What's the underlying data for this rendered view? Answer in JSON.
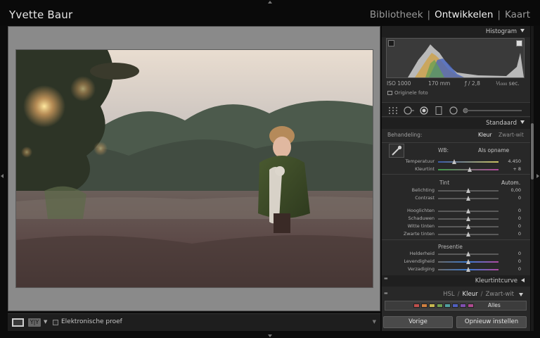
{
  "app": {
    "identity": "Yvette Baur",
    "modules": [
      {
        "label": "Bibliotheek",
        "active": false
      },
      {
        "label": "Ontwikkelen",
        "active": true
      },
      {
        "label": "Kaart",
        "active": false
      }
    ],
    "module_separator": "|"
  },
  "histogram": {
    "title": "Histogram",
    "iso": "ISO 1000",
    "focal": "170 mm",
    "aperture": "ƒ / 2,8",
    "shutter": "¹⁄₁₀₀₀ sec.",
    "original_photo": "Originele foto"
  },
  "basic": {
    "title": "Standaard",
    "treatment_label": "Behandeling:",
    "treatment_options": [
      "Kleur",
      "Zwart-wit"
    ],
    "treatment_selected": "Kleur",
    "wb_label": "WB:",
    "wb_value": "Als opname",
    "wb_sliders": [
      {
        "label": "Temperatuur",
        "value": "4.450",
        "position": 0.27
      },
      {
        "label": "Kleurtint",
        "value": "+ 8",
        "position": 0.52
      }
    ],
    "tone_label": "Tint",
    "auto_label": "Autom.",
    "tone_sliders": [
      {
        "label": "Belichting",
        "value": "0,00",
        "position": 0.5
      },
      {
        "label": "Contrast",
        "value": "0",
        "position": 0.5
      }
    ],
    "tone_sliders_2": [
      {
        "label": "Hooglichten",
        "value": "0",
        "position": 0.5
      },
      {
        "label": "Schaduwen",
        "value": "0",
        "position": 0.5
      },
      {
        "label": "Witte tinten",
        "value": "0",
        "position": 0.5
      },
      {
        "label": "Zwarte tinten",
        "value": "0",
        "position": 0.5
      }
    ],
    "presence_label": "Presentie",
    "presence_sliders": [
      {
        "label": "Helderheid",
        "value": "0",
        "position": 0.5
      },
      {
        "label": "Levendigheid",
        "value": "0",
        "position": 0.5
      },
      {
        "label": "Verzadiging",
        "value": "0",
        "position": 0.5
      }
    ]
  },
  "tone_curve": {
    "title": "Kleurtintcurve"
  },
  "hsl": {
    "tabs": [
      {
        "label": "HSL",
        "active": false
      },
      {
        "label": "Kleur",
        "active": true
      },
      {
        "label": "Zwart-wit",
        "active": false
      }
    ],
    "swatch_colors": [
      "#c0504d",
      "#d08040",
      "#c8b850",
      "#70a050",
      "#50a0a0",
      "#5060c0",
      "#8050b0",
      "#b04a90"
    ],
    "all_label": "Alles"
  },
  "toolbar": {
    "proof_label": "Elektronische proef",
    "proof_checked": false
  },
  "buttons": {
    "previous": "Vorige",
    "reset": "Opnieuw instellen"
  },
  "icons": {
    "panel_collapse": "triangle-down-icon",
    "tone_curve_expand": "triangle-left-icon",
    "eyedropper": "eyedropper-icon",
    "crop": "crop-grid-icon",
    "spot": "spot-removal-icon",
    "redeye": "red-eye-icon",
    "gradient": "graduated-filter-icon",
    "radial": "radial-filter-icon",
    "brush": "adjustment-brush-icon"
  }
}
